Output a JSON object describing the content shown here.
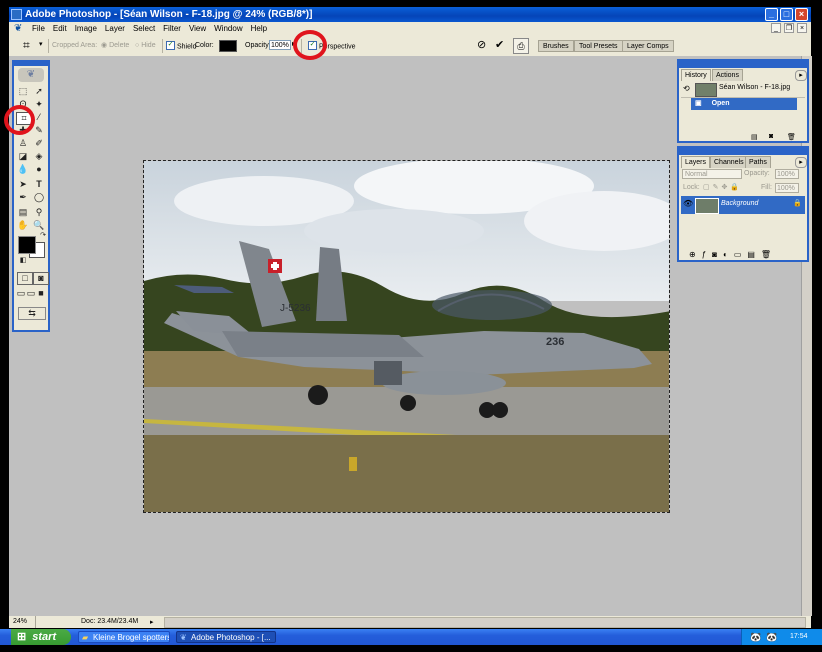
{
  "window": {
    "title": "Adobe Photoshop - [Séan Wilson - F-18.jpg @ 24% (RGB/8*)]",
    "controls": {
      "minimize": "_",
      "maximize": "□",
      "close": "×"
    }
  },
  "menu": [
    "File",
    "Edit",
    "Image",
    "Layer",
    "Select",
    "Filter",
    "View",
    "Window",
    "Help"
  ],
  "options_bar": {
    "cropped_area_label": "Cropped Area:",
    "delete_label": "Delete",
    "hide_label": "Hide",
    "shield_label": "Shield",
    "color_label": "Color:",
    "shield_color": "#000000",
    "opacity_label": "Opacity:",
    "opacity_value": "100%",
    "perspective_label": "Perspective",
    "perspective_checked": true,
    "cancel_icon": "cancel-icon",
    "commit_icon": "checkmark-icon",
    "palette_well": [
      "Brushes",
      "Tool Presets",
      "Layer Comps"
    ]
  },
  "history_panel": {
    "tabs": [
      "History",
      "Actions"
    ],
    "snapshot_label": "Séan Wilson - F-18.jpg",
    "states": [
      "Open"
    ]
  },
  "layers_panel": {
    "tabs": [
      "Layers",
      "Channels",
      "Paths"
    ],
    "blend_mode": "Normal",
    "opacity_label": "Opacity:",
    "opacity_value": "100%",
    "lock_label": "Lock:",
    "fill_label": "Fill:",
    "fill_value": "100%",
    "layers": [
      {
        "name": "Background"
      }
    ]
  },
  "document": {
    "aircraft_code": "J-5236",
    "nose_number": "236"
  },
  "status_bar": {
    "zoom": "24%",
    "doc_info": "Doc: 23.4M/23.4M"
  },
  "taskbar": {
    "start_label": "start",
    "items": [
      "Kleine Brogel spotters...",
      "Adobe Photoshop - [..."
    ],
    "clock": "17:54"
  },
  "colors": {
    "accent": "#2a63c8",
    "highlight_circle": "#e0141c",
    "history_selected": "#316ac5",
    "workspace": "#c0c0c0"
  }
}
